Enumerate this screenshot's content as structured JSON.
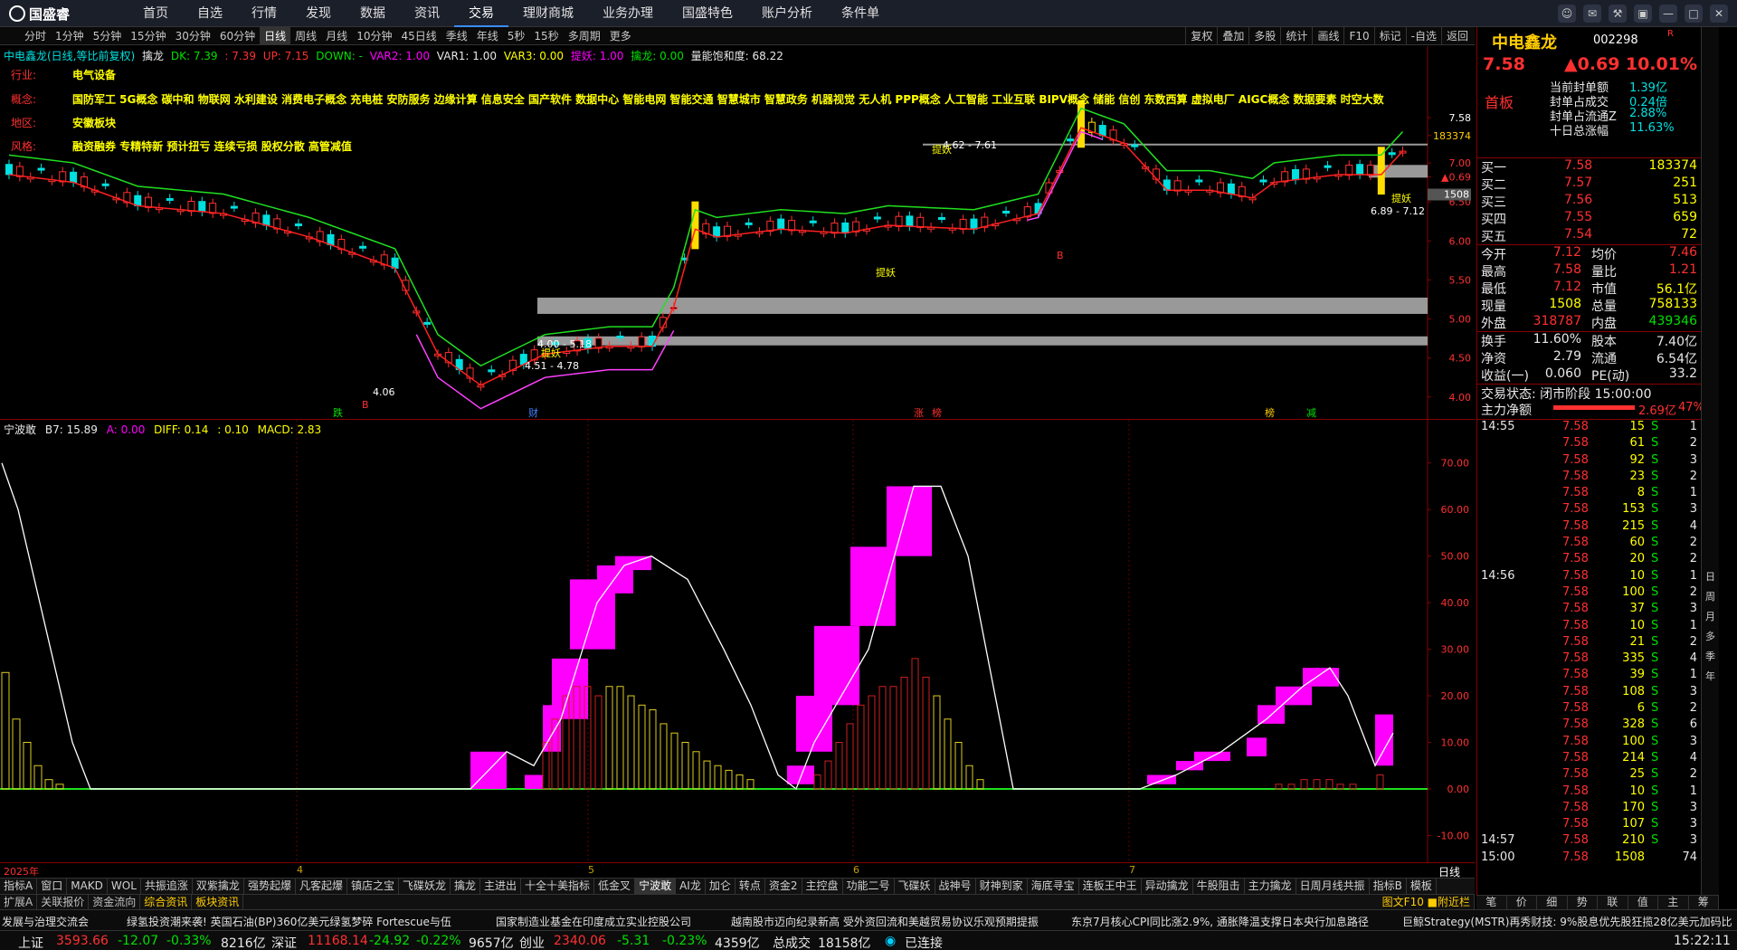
{
  "app": {
    "logo": "国盛睿"
  },
  "menu": [
    "首页",
    "自选",
    "行情",
    "发现",
    "数据",
    "资讯",
    "交易",
    "理财商城",
    "业务办理",
    "国盛特色",
    "账户分析",
    "条件单"
  ],
  "menu_active": "交易",
  "periods": [
    "分时",
    "1分钟",
    "5分钟",
    "15分钟",
    "30分钟",
    "60分钟",
    "日线",
    "周线",
    "月线",
    "10分钟",
    "45日线",
    "季线",
    "年线",
    "5秒",
    "15秒",
    "多周期",
    "更多"
  ],
  "period_active": "日线",
  "right_tools": [
    "复权",
    "叠加",
    "多股",
    "统计",
    "画线",
    "F10",
    "标记",
    "-自选",
    "返回"
  ],
  "main": {
    "legend": {
      "title": "中电鑫龙(日线,等比前复权)",
      "ind": "擒龙",
      "dk": "DK: 7.39",
      "v2": ": 7.39",
      "up": "UP: 7.15",
      "down": "DOWN: -",
      "var2": "VAR2: 1.00",
      "var1": "VAR1: 1.00",
      "var3": "VAR3: 0.00",
      "tiyao": "提妖: 1.00",
      "qinlong": "擒龙: 0.00",
      "liangneng": "量能饱和度: 68.22"
    },
    "info": [
      {
        "k": "行业:",
        "v": "电气设备"
      },
      {
        "k": "概念:",
        "v": "国防军工 5G概念 碳中和 物联网 水利建设 消费电子概念 充电桩 安防服务 边缘计算 信息安全 国产软件 数据中心 智能电网 智能交通 智慧城市 智慧政务 机器视觉 无人机 PPP概念 人工智能 工业互联 BIPV概念 储能 信创 东数西算 虚拟电厂 AIGC概念 数据要素 时空大数"
      },
      {
        "k": "地区:",
        "v": "安徽板块"
      },
      {
        "k": "风格:",
        "v": "融资融券 专精特新 预计扭亏 连续亏损 股权分散 高管减值"
      }
    ],
    "yaxis": [
      "7.58",
      "183374",
      "7.00",
      "▲0.69",
      "10.01%",
      "1508",
      "6.50",
      "6.00",
      "5.50",
      "5.00",
      "4.50",
      "4.00"
    ],
    "annotations": {
      "low_price": "4.06",
      "range1": "4.00 - 5.18",
      "range2": "4.51 - 4.78",
      "range3": "4.62 - 7.61",
      "range4": "6.89 - 7.12",
      "tiyao": "提妖",
      "b": "B",
      "die": "跌",
      "cai": "财",
      "zhang": "涨",
      "bang": "榜",
      "bang2": "榜",
      "jian": "减"
    }
  },
  "sub": {
    "legend": {
      "name": "宁波敢",
      "b7": "B7: 15.89",
      "a": "A: 0.00",
      "diff": "DIFF: 0.14",
      "v": ": 0.10",
      "macd": "MACD: 2.83"
    },
    "yaxis": [
      "70.00",
      "60.00",
      "50.00",
      "40.00",
      "30.00",
      "20.00",
      "10.00",
      "0.00",
      "-10.00"
    ]
  },
  "dates": {
    "y": "2025年",
    "m4": "4",
    "m5": "5",
    "m6": "6",
    "m7": "7",
    "label": "日线"
  },
  "tabs1": [
    "指标A",
    "窗口",
    "MAKD",
    "WOL",
    "共振追涨",
    "双紫擒龙",
    "强势起爆",
    "凡客起爆",
    "镇店之宝",
    "飞碟妖龙",
    "擒龙",
    "主进出",
    "十全十美指标",
    "低金叉",
    "宁波敢",
    "AI龙",
    "加仑",
    "转点",
    "资金2",
    "主控盘",
    "功能二号",
    "飞碟妖",
    "战神号",
    "财神到家",
    "海底寻宝",
    "连板王中王",
    "异动擒龙",
    "牛股阻击",
    "主力擒龙",
    "日周月线共振",
    "指标B",
    "模板"
  ],
  "tabs1_active": "宁波敢",
  "tabs2": [
    "扩展A",
    "关联报价",
    "资金流向",
    "综合资讯",
    "板块资讯"
  ],
  "tabs2_right": "图文F10 ■附近栏",
  "ticker": [
    "发展与治理交流会",
    "绿氢投资潮来袭! 英国石油(BP)360亿美元绿氢梦碎 Fortescue与伍",
    "国家制造业基金在印度成立实业控股公司",
    "越南股市迈向纪录新高 受外资回流和美越贸易协议乐观预期提振",
    "东京7月核心CPI同比涨2.9%, 通胀降温支撑日本央行加息路径",
    "巨鲸Strategy(MSTR)再秀财技: 9%股息优先股狂揽28亿美元加码比"
  ],
  "status": {
    "sh": "上证",
    "sh_v": "3593.66",
    "sh_c": "-12.07",
    "sh_p": "-0.33%",
    "sh_a": "8216亿",
    "sz": "深证",
    "sz_v": "11168.14",
    "sz_c": "-24.92",
    "sz_p": "-0.22%",
    "sz_a": "9657亿",
    "cy": "创业",
    "cy_v": "2340.06",
    "cy_c": "-5.31",
    "cy_p": "-0.23%",
    "cy_a": "4359亿",
    "total_l": "总成交",
    "total_v": "18158亿",
    "conn": "已连接",
    "time": "15:22:11"
  },
  "quote": {
    "name": "中电鑫龙",
    "code": "002298",
    "r": "R",
    "price": "7.58",
    "change": "▲0.69",
    "pct": "10.01%",
    "tag": "首板",
    "seal": [
      {
        "k": "当前封单额",
        "v": "1.39亿"
      },
      {
        "k": "封单占成交",
        "v": "0.24倍"
      },
      {
        "k": "封单占流通Z",
        "v": "2.88%"
      },
      {
        "k": "十日总涨幅",
        "v": "11.63%"
      }
    ],
    "bids": [
      {
        "l": "买一",
        "p": "7.58",
        "v": "183374"
      },
      {
        "l": "买二",
        "p": "7.57",
        "v": "251"
      },
      {
        "l": "买三",
        "p": "7.56",
        "v": "513"
      },
      {
        "l": "买四",
        "p": "7.55",
        "v": "659"
      },
      {
        "l": "买五",
        "p": "7.54",
        "v": "72"
      }
    ],
    "stats": [
      {
        "k1": "今开",
        "v1": "7.12",
        "k2": "均价",
        "v2": "7.46"
      },
      {
        "k1": "最高",
        "v1": "7.58",
        "k2": "量比",
        "v2": "1.21"
      },
      {
        "k1": "最低",
        "v1": "7.12",
        "k2": "市值",
        "v2": "56.1亿"
      },
      {
        "k1": "现量",
        "v1": "1508",
        "k2": "总量",
        "v2": "758133"
      },
      {
        "k1": "外盘",
        "v1": "318787",
        "k2": "内盘",
        "v2": "439346"
      }
    ],
    "stats2": [
      {
        "k1": "换手",
        "v1": "11.60%",
        "k2": "股本",
        "v2": "7.40亿"
      },
      {
        "k1": "净资",
        "v1": "2.79",
        "k2": "流通",
        "v2": "6.54亿"
      },
      {
        "k1": "收益(一)",
        "v1": "0.060",
        "k2": "PE(动)",
        "v2": "33.2"
      }
    ],
    "trade_state": "交易状态: 闭市阶段 15:00:00",
    "mainflow_l": "主力净额",
    "mainflow_v": "2.69亿",
    "mainflow_p": "47%",
    "ticks_times": [
      "14:55",
      "14:56",
      "14:57",
      "15:00"
    ],
    "ticks": [
      [
        "7.58",
        "15",
        "S",
        "1"
      ],
      [
        "7.58",
        "61",
        "S",
        "2"
      ],
      [
        "7.58",
        "92",
        "S",
        "3"
      ],
      [
        "7.58",
        "23",
        "S",
        "2"
      ],
      [
        "7.58",
        "8",
        "S",
        "1"
      ],
      [
        "7.58",
        "153",
        "S",
        "3"
      ],
      [
        "7.58",
        "215",
        "S",
        "4"
      ],
      [
        "7.58",
        "60",
        "S",
        "2"
      ],
      [
        "7.58",
        "20",
        "S",
        "2"
      ],
      [
        "7.58",
        "10",
        "S",
        "1"
      ],
      [
        "7.58",
        "100",
        "S",
        "2"
      ],
      [
        "7.58",
        "37",
        "S",
        "3"
      ],
      [
        "7.58",
        "10",
        "S",
        "1"
      ],
      [
        "7.58",
        "21",
        "S",
        "2"
      ],
      [
        "7.58",
        "335",
        "S",
        "4"
      ],
      [
        "7.58",
        "39",
        "S",
        "1"
      ],
      [
        "7.58",
        "108",
        "S",
        "3"
      ],
      [
        "7.58",
        "6",
        "S",
        "2"
      ],
      [
        "7.58",
        "328",
        "S",
        "6"
      ],
      [
        "7.58",
        "100",
        "S",
        "3"
      ],
      [
        "7.58",
        "214",
        "S",
        "4"
      ],
      [
        "7.58",
        "25",
        "S",
        "2"
      ],
      [
        "7.58",
        "10",
        "S",
        "1"
      ],
      [
        "7.58",
        "170",
        "S",
        "3"
      ],
      [
        "7.58",
        "107",
        "S",
        "3"
      ],
      [
        "7.58",
        "210",
        "S",
        "3"
      ],
      [
        "7.58",
        "1508",
        "",
        "74"
      ]
    ],
    "vtabs": [
      "日",
      "周",
      "月",
      "多",
      "季",
      "年"
    ],
    "bottom_tabs": [
      "笔",
      "价",
      "细",
      "势",
      "联",
      "值",
      "主",
      "筹"
    ]
  }
}
